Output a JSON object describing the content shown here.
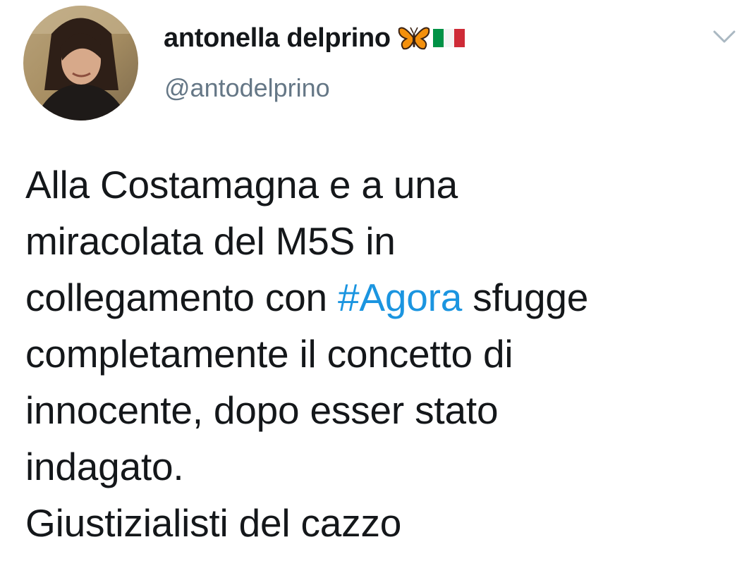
{
  "author": {
    "display_name": "antonella delprino",
    "handle": "@antodelprino",
    "name_emojis": [
      "butterfly-emoji",
      "italy-flag-emoji"
    ]
  },
  "tweet": {
    "line1": "Alla Costamagna e a una",
    "line2": "miracolata del M5S in",
    "line3_before": "collegamento con ",
    "line3_hashtag": "#Agora",
    "line3_after": " sfugge",
    "line4": "completamente il concetto di",
    "line5": "innocente, dopo esser stato",
    "line6": "indagato.",
    "line7": "Giustizialisti del cazzo"
  },
  "colors": {
    "text": "#14171a",
    "secondary": "#657786",
    "link": "#1b95e0",
    "caret": "#aab8c2"
  }
}
